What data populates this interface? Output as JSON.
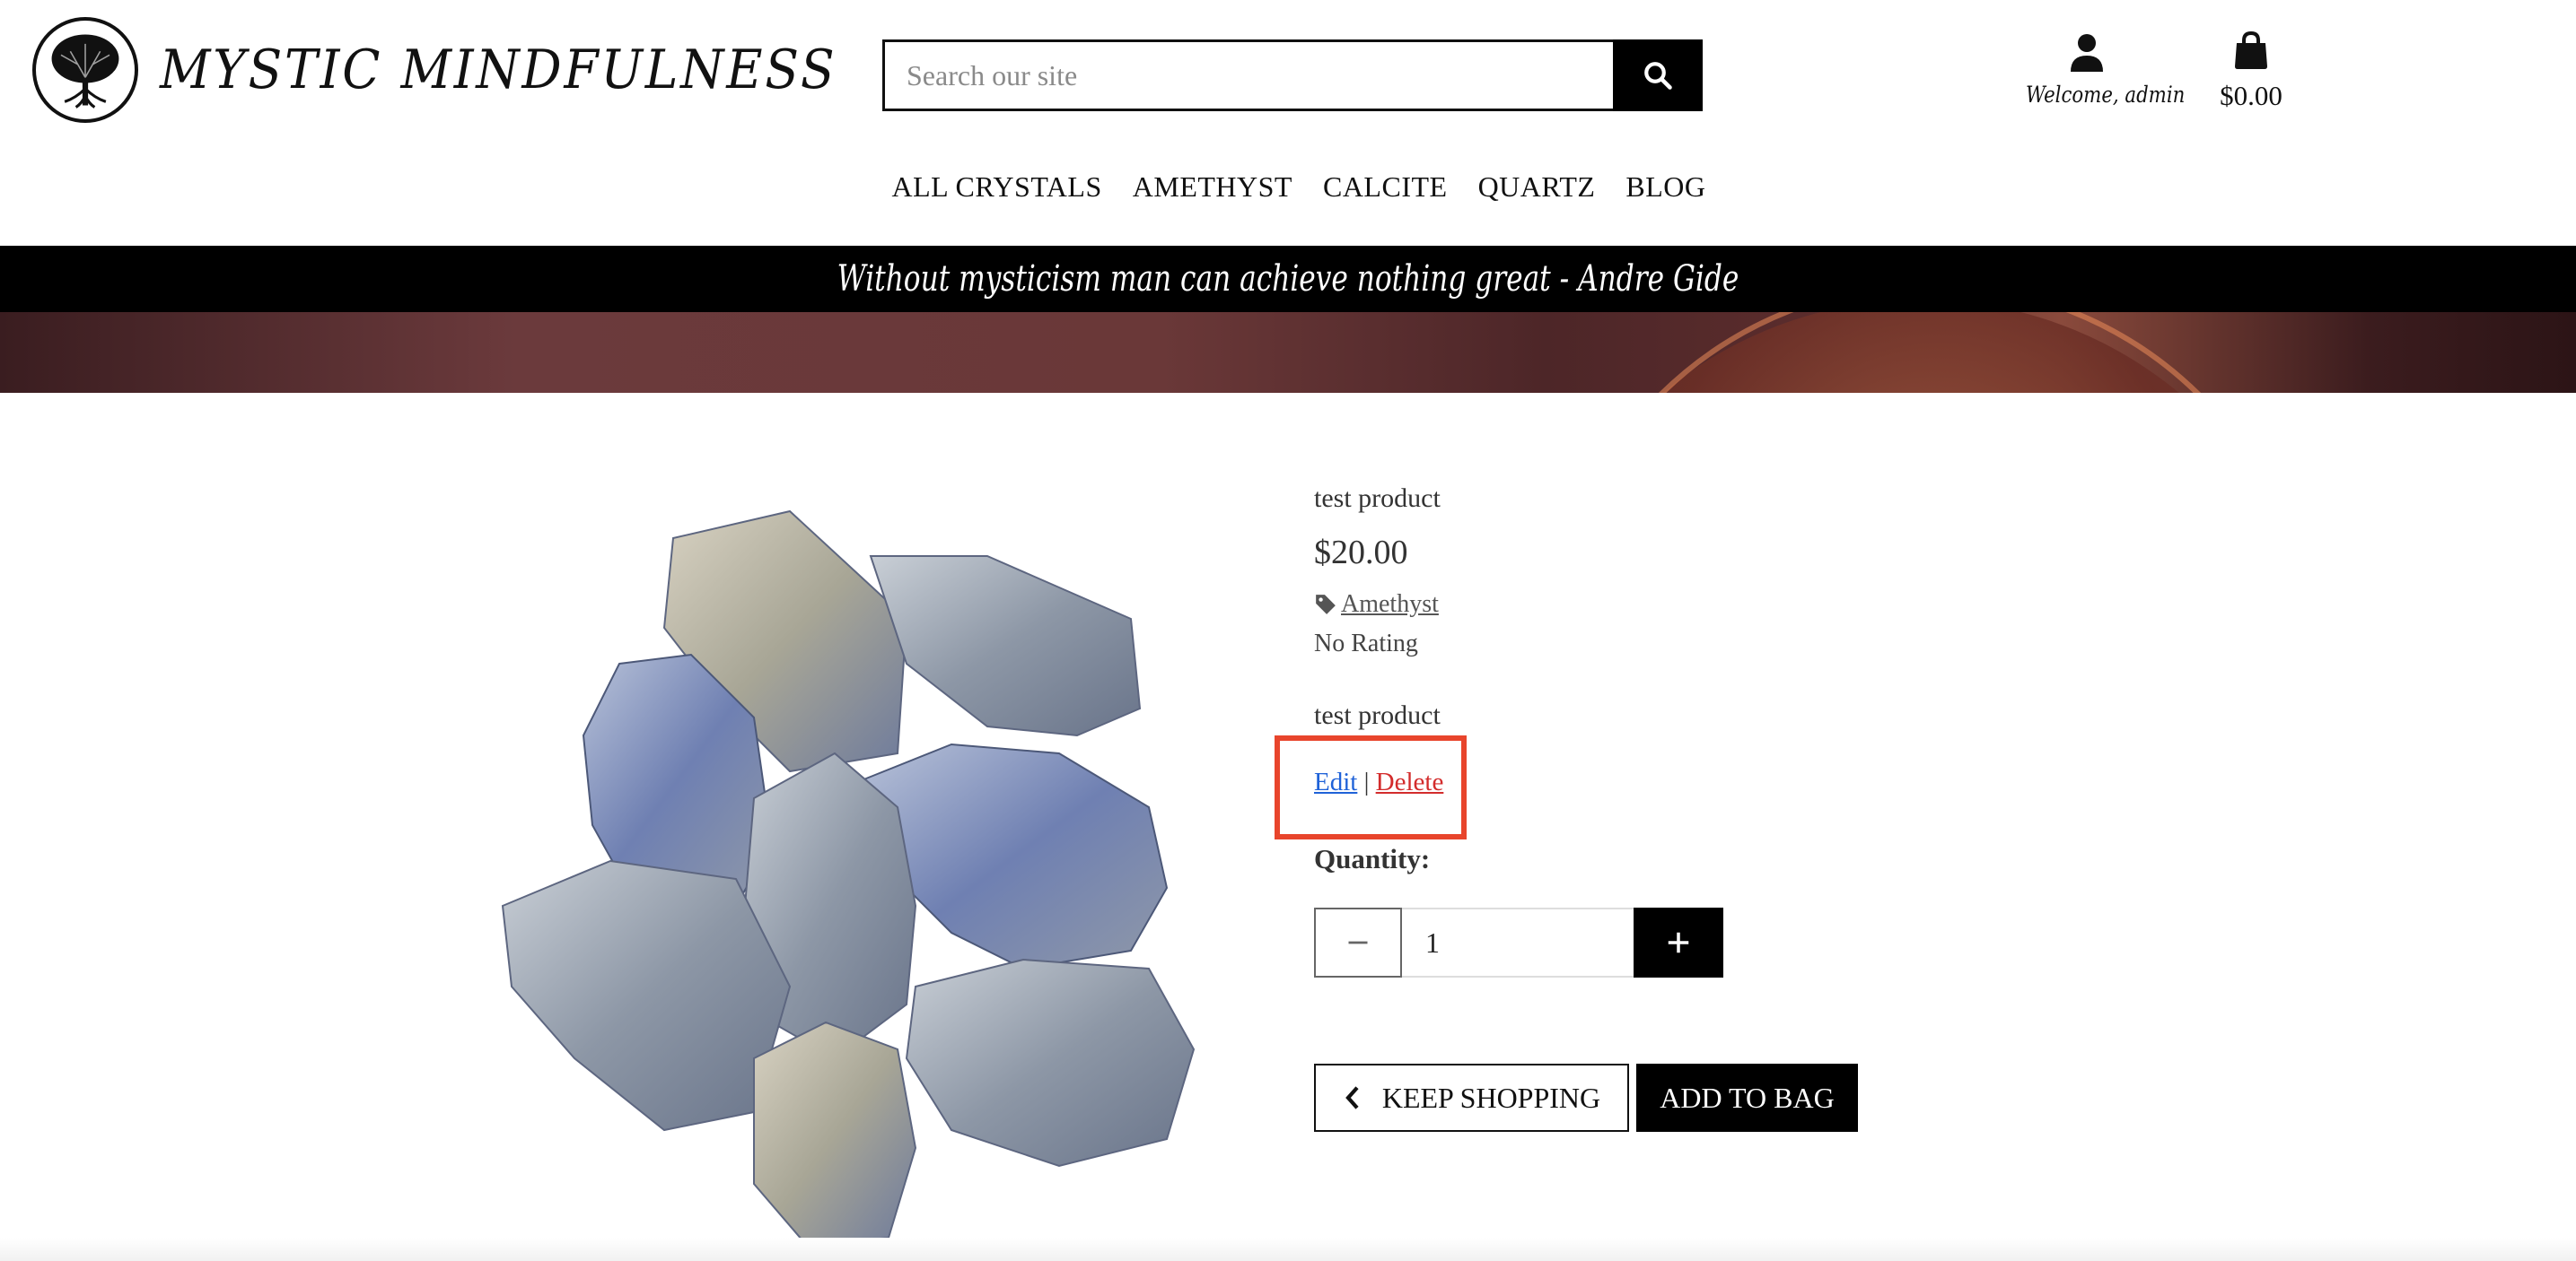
{
  "brand": {
    "name": "MYSTIC MINDFULNESS",
    "logo_icon": "tree-of-life-icon"
  },
  "search": {
    "placeholder": "Search our site",
    "icon": "search-icon"
  },
  "account": {
    "label": "Welcome, admin",
    "icon": "user-icon"
  },
  "bag": {
    "amount": "$0.00",
    "icon": "shopping-bag-icon"
  },
  "nav": {
    "items": [
      {
        "label": "ALL CRYSTALS"
      },
      {
        "label": "AMETHYST"
      },
      {
        "label": "CALCITE"
      },
      {
        "label": "QUARTZ"
      },
      {
        "label": "BLOG"
      }
    ]
  },
  "banner": {
    "quote": "Without mysticism man can achieve nothing great - Andre Gide"
  },
  "product": {
    "name": "test product",
    "price": "$20.00",
    "category": "Amethyst",
    "category_icon": "tag-icon",
    "rating": "No Rating",
    "description": "test product",
    "admin": {
      "edit": "Edit",
      "separator": "|",
      "delete": "Delete"
    },
    "quantity_label": "Quantity:",
    "quantity_value": "1",
    "keep_shopping": "KEEP SHOPPING",
    "add_to_bag": "ADD TO BAG"
  },
  "colors": {
    "accent": "#000000",
    "edit_link": "#1f62d8",
    "delete_link": "#d32c2c",
    "highlight": "#e8452c"
  }
}
